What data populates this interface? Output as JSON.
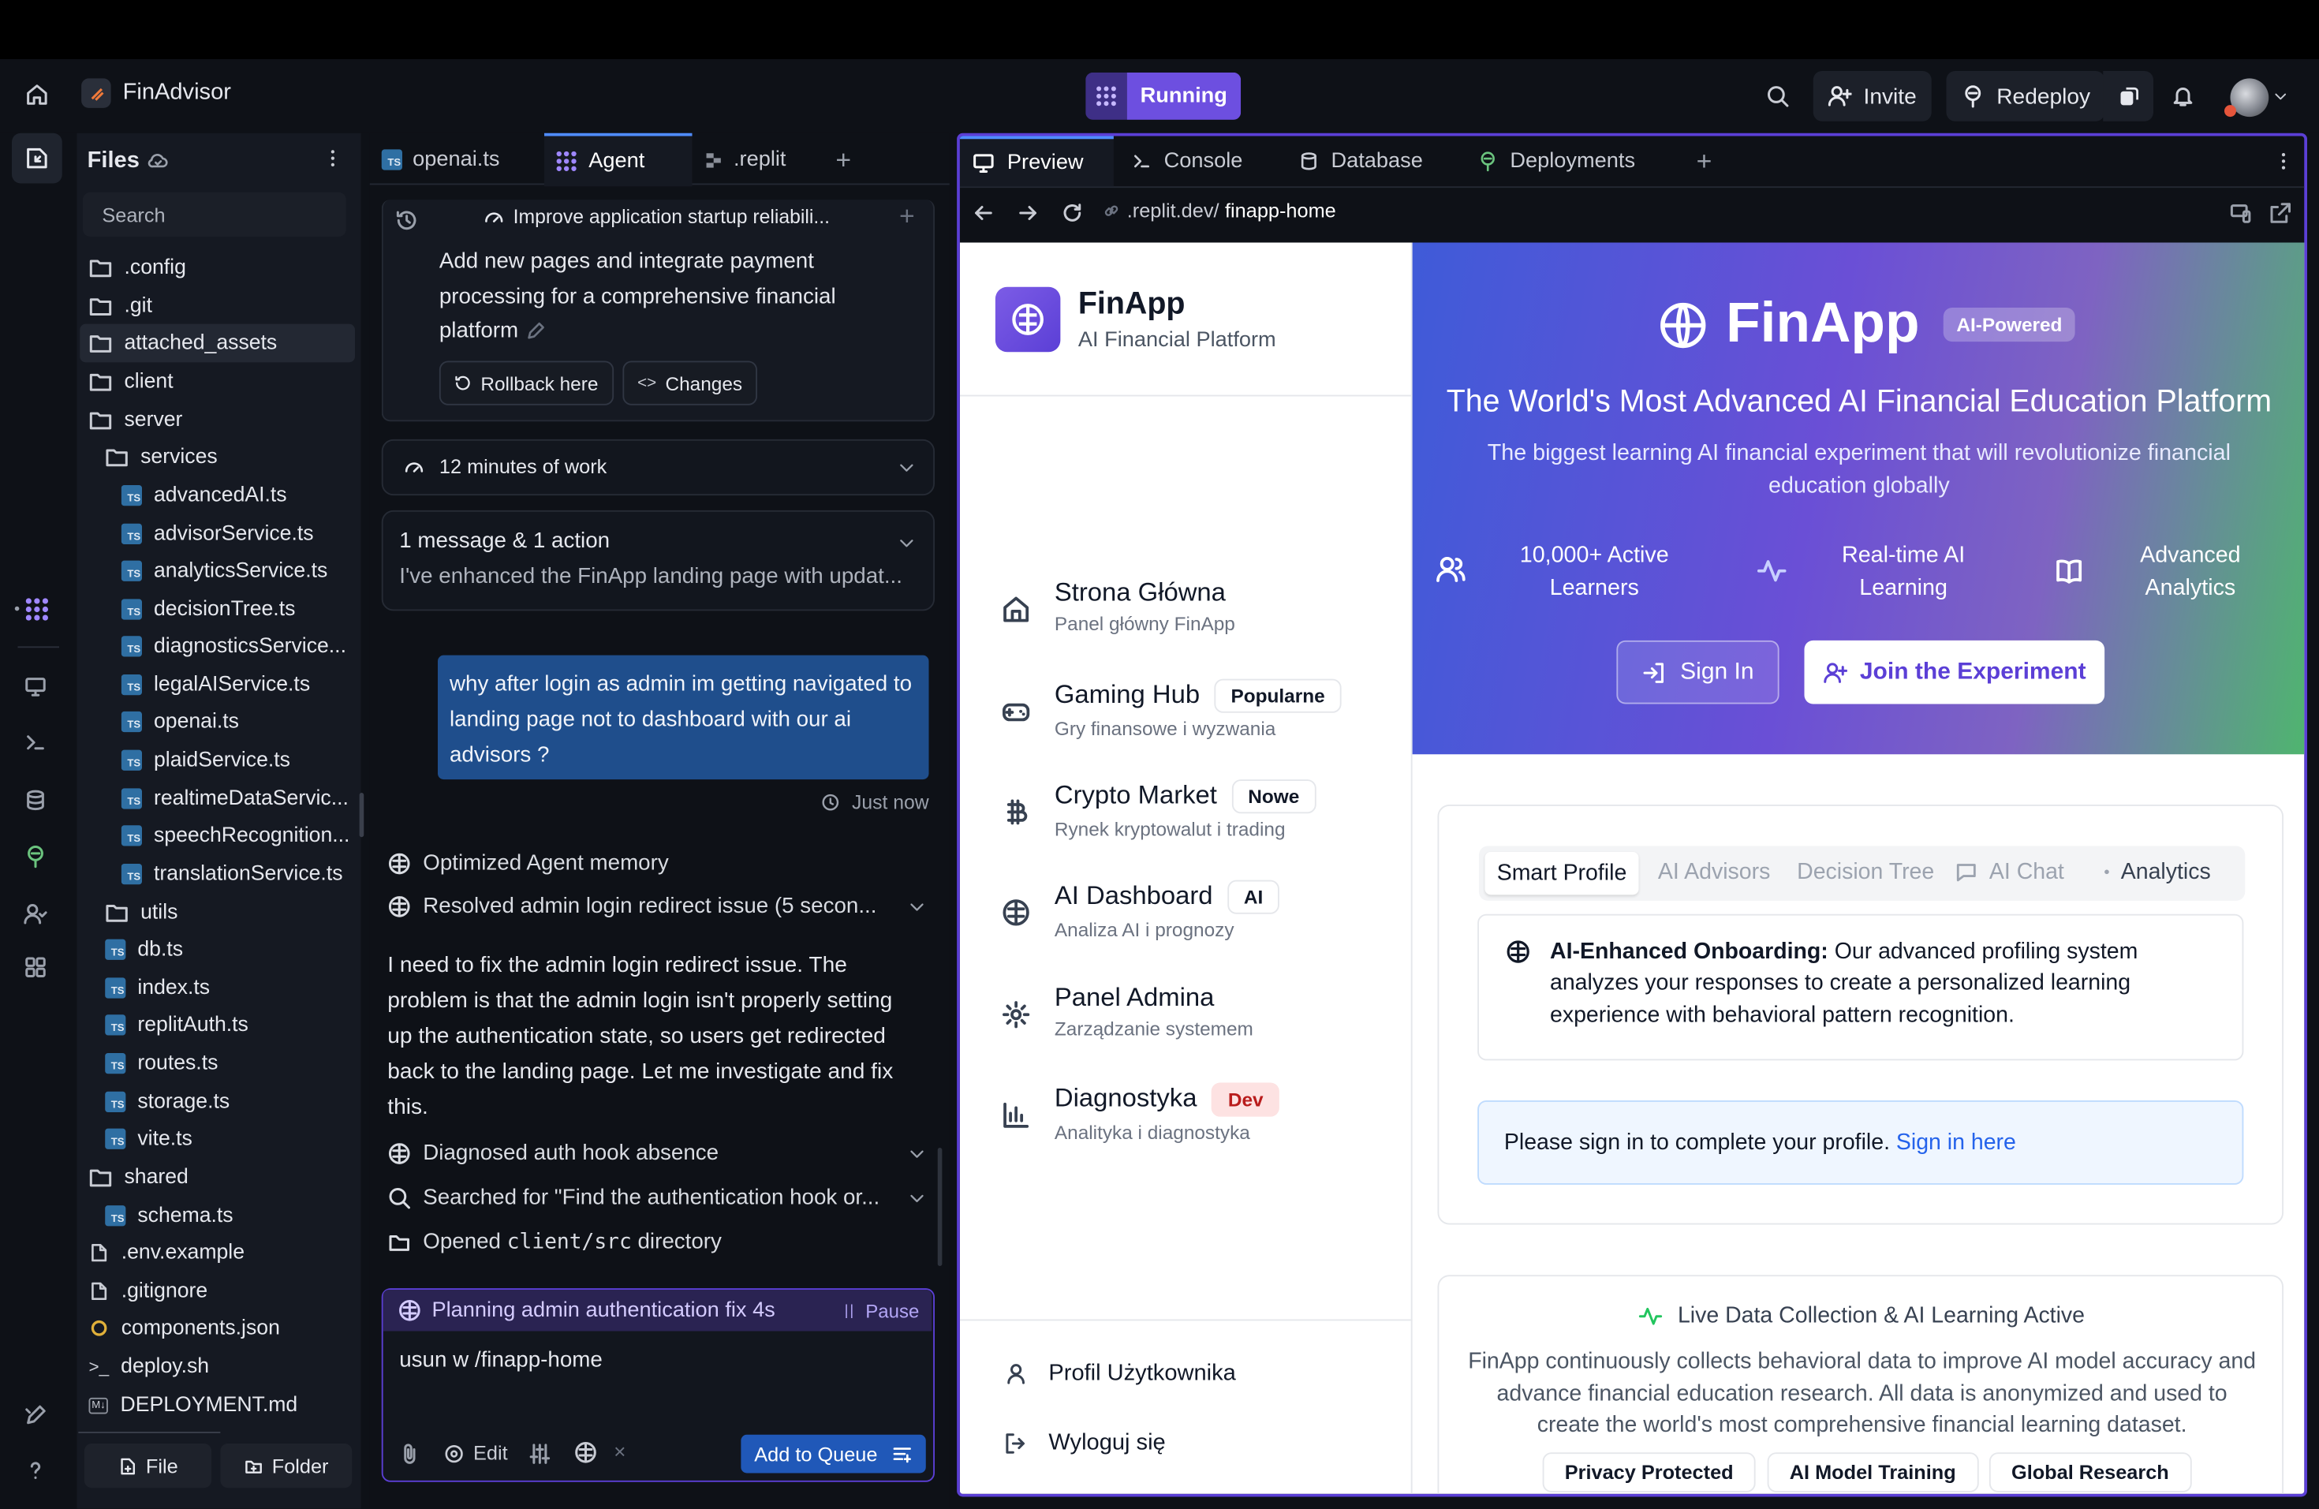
{
  "topbar": {
    "project": "FinAdvisor",
    "run_label": "Running",
    "invite": "Invite",
    "redeploy": "Redeploy"
  },
  "files": {
    "title": "Files",
    "search_placeholder": "Search",
    "new_file": "File",
    "new_folder": "Folder",
    "items": [
      ".config",
      ".git",
      "attached_assets",
      "client",
      "server",
      "services",
      "advancedAI.ts",
      "advisorService.ts",
      "analyticsService.ts",
      "decisionTree.ts",
      "diagnosticsService...",
      "legalAIService.ts",
      "openai.ts",
      "plaidService.ts",
      "realtimeDataServic...",
      "speechRecognition...",
      "translationService.ts",
      "utils",
      "db.ts",
      "index.ts",
      "replitAuth.ts",
      "routes.ts",
      "storage.ts",
      "vite.ts",
      "shared",
      "schema.ts",
      ".env.example",
      ".gitignore",
      "components.json",
      "deploy.sh",
      "DEPLOYMENT.md"
    ]
  },
  "agent": {
    "tabs": [
      "openai.ts",
      "Agent",
      ".replit"
    ],
    "thread_title": "Improve application startup reliabili...",
    "prev_message": "Add new pages and integrate payment processing for a comprehensive financial platform",
    "rollback": "Rollback here",
    "changes": "Changes",
    "work_time": "12 minutes of work",
    "summary_title": "1 message & 1 action",
    "summary_text": "I've enhanced the FinApp landing page with updat...",
    "user_message": "why after login as admin im getting navigated to landing page not to dashboard with our ai advisors ?",
    "timestamp": "Just now",
    "step1": "Optimized Agent memory",
    "step2": "Resolved admin login redirect issue (5 secon...",
    "reply": "I need to fix the admin login redirect issue. The problem is that the admin login isn't properly setting up the authentication state, so users get redirected back to the landing page. Let me investigate and fix this.",
    "step3": "Diagnosed auth hook absence",
    "step4": "Searched for \"Find the authentication hook or...",
    "step5_pre": "Opened ",
    "step5_code": "client/src",
    "step5_post": " directory",
    "planning": "Planning admin authentication fix 4s",
    "pause": "Pause",
    "input_value": "usun w /finapp-home",
    "edit": "Edit",
    "queue": "Add to Queue"
  },
  "preview": {
    "tabs": [
      "Preview",
      "Console",
      "Database",
      "Deployments"
    ],
    "url_prefix": ".replit.dev/",
    "url_path": "finapp-home"
  },
  "app": {
    "brand": "FinApp",
    "brand_sub": "AI Financial Platform",
    "nav": [
      {
        "title": "Strona Główna",
        "sub": "Panel główny FinApp",
        "tag": ""
      },
      {
        "title": "Gaming Hub",
        "sub": "Gry finansowe i wyzwania",
        "tag": "Popularne"
      },
      {
        "title": "Crypto Market",
        "sub": "Rynek kryptowalut i trading",
        "tag": "Nowe"
      },
      {
        "title": "AI Dashboard",
        "sub": "Analiza AI i prognozy",
        "tag": "AI"
      },
      {
        "title": "Panel Admina",
        "sub": "Zarządzanie systemem",
        "tag": ""
      },
      {
        "title": "Diagnostyka",
        "sub": "Analityka i diagnostyka",
        "tag": "Dev"
      }
    ],
    "profile": "Profil Użytkownika",
    "logout": "Wyloguj się",
    "hero_title": "FinApp",
    "hero_badge": "AI-Powered",
    "hero_heading": "The World's Most Advanced AI Financial Education Platform",
    "hero_sub": "The biggest learning AI financial experiment that will revolutionize financial education globally",
    "stat1": "10,000+ Active Learners",
    "stat2": "Real-time AI Learning",
    "stat3": "Advanced Analytics",
    "sign_in": "Sign In",
    "join": "Join the Experiment",
    "tabs": [
      "Smart Profile",
      "AI Advisors",
      "Decision Tree",
      "AI Chat",
      "Analytics"
    ],
    "onb_bold": "AI-Enhanced Onboarding:",
    "onb_text": " Our advanced profiling system analyzes your responses to create a personalized learning experience with behavioral pattern recognition.",
    "signin_prompt": "Please sign in to complete your profile. ",
    "signin_link": "Sign in here",
    "live_title": "Live Data Collection & AI Learning Active",
    "live_text": "FinApp continuously collects behavioral data to improve AI model accuracy and advance financial education research. All data is anonymized and used to create the world's most comprehensive financial learning dataset.",
    "chips": [
      "Privacy Protected",
      "AI Model Training",
      "Global Research"
    ]
  },
  "colors": {
    "accent": "#5b3fd6",
    "running": "#6d4fe0",
    "link": "#2563eb",
    "user_bubble": "#1f4e8c"
  }
}
